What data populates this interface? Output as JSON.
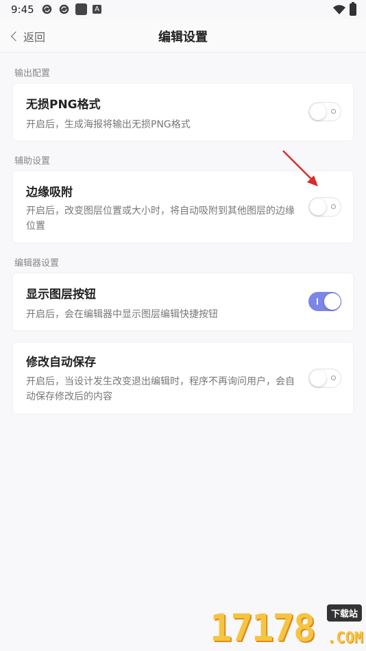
{
  "status_bar": {
    "time": "9:45",
    "notification_icons": [
      "sync-icon",
      "sync-icon",
      "square-app-icon",
      "a-app-icon"
    ],
    "a_icon_glyph": "A"
  },
  "navbar": {
    "back_label": "返回",
    "title": "编辑设置"
  },
  "sections": {
    "output": "输出配置",
    "assist": "辅助设置",
    "editor": "编辑器设置"
  },
  "settings": [
    {
      "title": "无损PNG格式",
      "desc": "开启后，生成海报将输出无损PNG格式",
      "enabled": false
    },
    {
      "title": "边缘吸附",
      "desc": "开启后，改变图层位置或大小时，将自动吸附到其他图层的边缘位置",
      "enabled": false
    },
    {
      "title": "显示图层按钮",
      "desc": "开启后，会在编辑器中显示图层编辑快捷按钮",
      "enabled": true
    },
    {
      "title": "修改自动保存",
      "desc": "开启后，当设计发生改变退出编辑时，程序不再询问用户，会自动保存修改后的内容",
      "enabled": false
    }
  ],
  "watermark": {
    "number": "17178",
    "badge": "下载站",
    "suffix": ".COM"
  },
  "colors": {
    "accent": "#7b86e6",
    "annotation_arrow": "#d92b2b"
  }
}
